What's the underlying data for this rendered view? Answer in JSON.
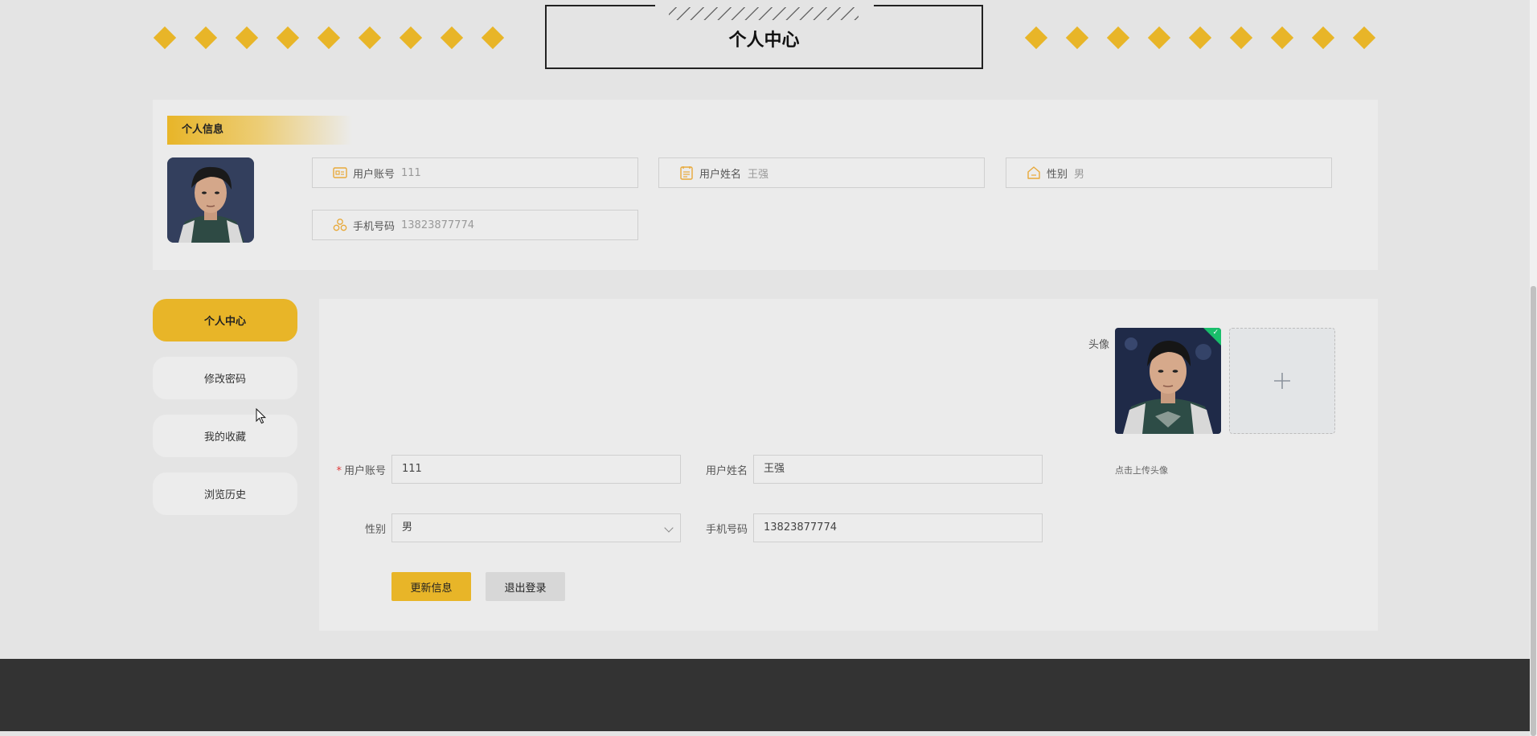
{
  "header": {
    "title": "个人中心"
  },
  "info": {
    "tag": "个人信息",
    "fields": [
      {
        "icon": "id-card-icon",
        "label": "用户账号",
        "value": "111"
      },
      {
        "icon": "document-icon",
        "label": "用户姓名",
        "value": "王强"
      },
      {
        "icon": "home-icon",
        "label": "性别",
        "value": "男"
      },
      {
        "icon": "phone-icon",
        "label": "手机号码",
        "value": "13823877774"
      }
    ]
  },
  "sidebar": {
    "items": [
      {
        "label": "个人中心",
        "active": true
      },
      {
        "label": "修改密码"
      },
      {
        "label": "我的收藏"
      },
      {
        "label": "浏览历史"
      }
    ]
  },
  "form": {
    "avatar_label": "头像",
    "upload_hint": "点击上传头像",
    "account": {
      "label": "用户账号",
      "value": "111",
      "required": true
    },
    "name": {
      "label": "用户姓名",
      "value": "王强"
    },
    "gender": {
      "label": "性别",
      "value": "男"
    },
    "phone": {
      "label": "手机号码",
      "value": "13823877774"
    },
    "update_button": "更新信息",
    "logout_button": "退出登录"
  },
  "colors": {
    "accent": "#e8b528",
    "footer": "#333333",
    "success": "#19be6b"
  }
}
